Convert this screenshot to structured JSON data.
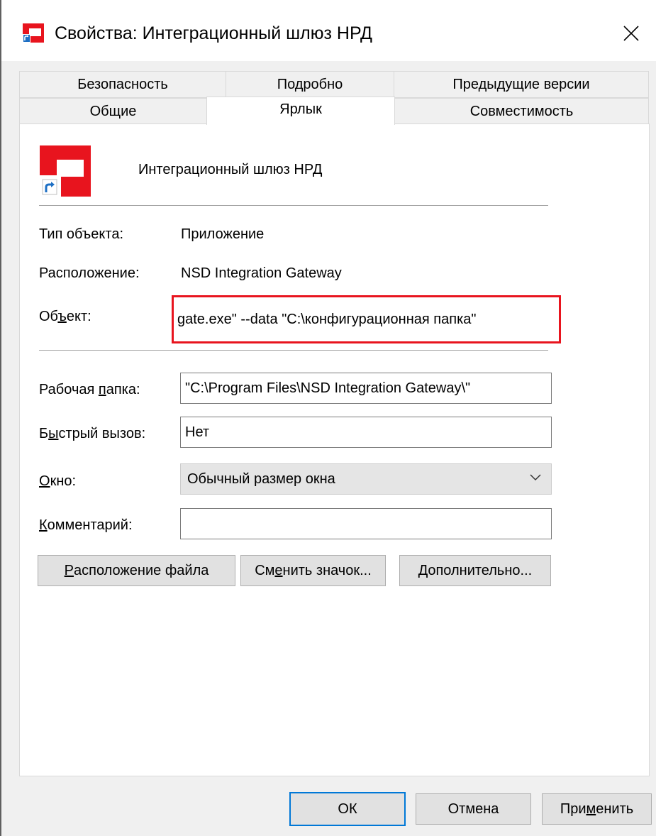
{
  "window": {
    "title": "Свойства: Интеграционный шлюз НРД",
    "close_glyph": "✕"
  },
  "tabs": {
    "row_top": [
      {
        "label": "Безопасность"
      },
      {
        "label": "Подробно"
      },
      {
        "label": "Предыдущие версии"
      }
    ],
    "row_bottom": [
      {
        "label": "Общие"
      },
      {
        "label": "Ярлык",
        "active": true
      },
      {
        "label": "Совместимость"
      }
    ]
  },
  "shortcut": {
    "name": "Интеграционный шлюз НРД",
    "icon": "nsd-gateway-shortcut-icon",
    "icon_color": "#e8141e"
  },
  "info": {
    "type_label": "Тип объекта:",
    "type_value": "Приложение",
    "location_label": "Расположение:",
    "location_value": "NSD Integration Gateway"
  },
  "target": {
    "label_pre": "Об",
    "label_u": "ъ",
    "label_post": "ект:",
    "value": "gate.exe\"  --data \"C:\\конфигурационная папка\"",
    "highlight_color": "#e8141e"
  },
  "start_in": {
    "label_pre": "Рабочая ",
    "label_u": "п",
    "label_post": "апка:",
    "value": "\"C:\\Program Files\\NSD Integration Gateway\\\""
  },
  "hotkey": {
    "label_pre": "Б",
    "label_u": "ы",
    "label_post": "стрый вызов:",
    "value": "Нет"
  },
  "run": {
    "label_u": "О",
    "label_post": "кно:",
    "value": "Обычный размер окна"
  },
  "comment": {
    "label_u": "К",
    "label_post": "омментарий:",
    "value": ""
  },
  "actions": {
    "open_location": {
      "u": "Р",
      "post": "асположение файла"
    },
    "change_icon": {
      "pre": "См",
      "u": "е",
      "post": "нить значок..."
    },
    "advanced": {
      "u": "Д",
      "post": "ополнительно..."
    }
  },
  "footer": {
    "ok": "ОК",
    "cancel": "Отмена",
    "apply_pre": "При",
    "apply_u": "м",
    "apply_post": "енить"
  },
  "colors": {
    "accent": "#0078d7",
    "brand_red": "#e8141e"
  }
}
